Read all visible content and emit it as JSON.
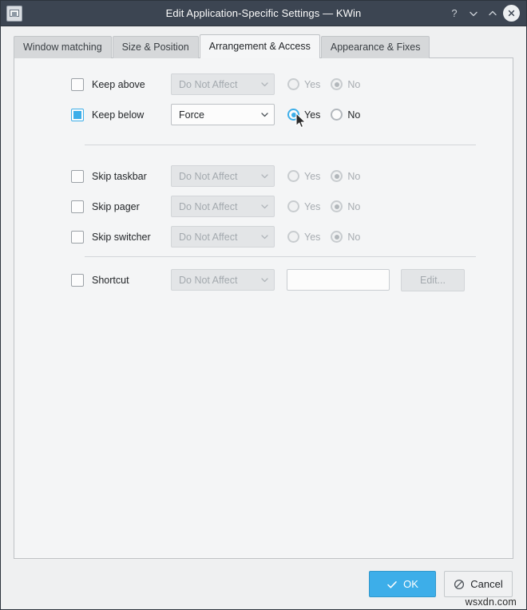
{
  "window": {
    "title": "Edit Application-Specific Settings — KWin",
    "icon": "window-settings-icon",
    "controls": [
      {
        "name": "help-button",
        "glyph": "?"
      },
      {
        "name": "minimize-button",
        "glyph": "v"
      },
      {
        "name": "maximize-button",
        "glyph": "^"
      },
      {
        "name": "close-button",
        "glyph": "x"
      }
    ]
  },
  "tabs": [
    {
      "label": "Window matching",
      "active": false
    },
    {
      "label": "Size & Position",
      "active": false
    },
    {
      "label": "Arrangement & Access",
      "active": true
    },
    {
      "label": "Appearance & Fixes",
      "active": false
    }
  ],
  "rows": {
    "keep_above": {
      "label": "Keep above",
      "checked": false,
      "combo_value": "Do Not Affect",
      "enabled": false,
      "radio_yes": "Yes",
      "radio_no": "No",
      "selected": "No"
    },
    "keep_below": {
      "label": "Keep below",
      "checked": true,
      "combo_value": "Force",
      "enabled": true,
      "radio_yes": "Yes",
      "radio_no": "No",
      "selected": "Yes"
    },
    "skip_taskbar": {
      "label": "Skip taskbar",
      "checked": false,
      "combo_value": "Do Not Affect",
      "enabled": false,
      "radio_yes": "Yes",
      "radio_no": "No",
      "selected": "No"
    },
    "skip_pager": {
      "label": "Skip pager",
      "checked": false,
      "combo_value": "Do Not Affect",
      "enabled": false,
      "radio_yes": "Yes",
      "radio_no": "No",
      "selected": "No"
    },
    "skip_switcher": {
      "label": "Skip switcher",
      "checked": false,
      "combo_value": "Do Not Affect",
      "enabled": false,
      "radio_yes": "Yes",
      "radio_no": "No",
      "selected": "No"
    },
    "shortcut": {
      "label": "Shortcut",
      "checked": false,
      "combo_value": "Do Not Affect",
      "enabled": false,
      "field_value": "",
      "edit_label": "Edit..."
    }
  },
  "buttons": {
    "ok_label": "OK",
    "cancel_label": "Cancel"
  },
  "watermark": "wsxdn.com",
  "colors": {
    "accent": "#3daee9",
    "titlebar": "#3c4552",
    "panel": "#f4f5f6",
    "window": "#eff0f1"
  }
}
